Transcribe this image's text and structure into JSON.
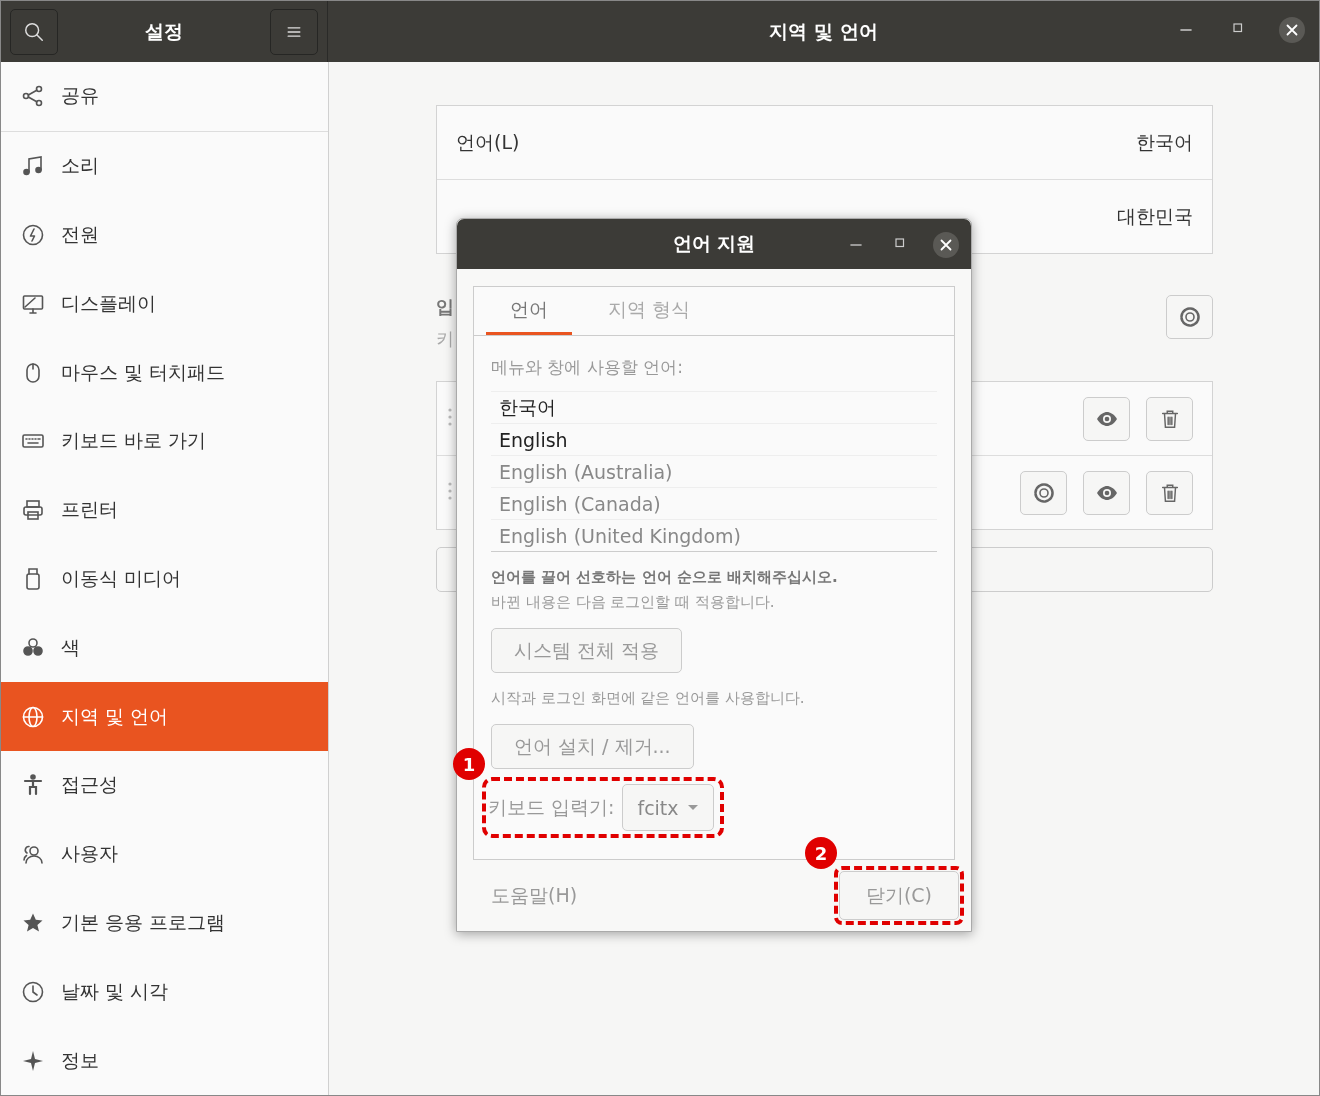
{
  "window": {
    "title": "지역 및 언어"
  },
  "sidebar": {
    "title": "설정",
    "items": [
      {
        "label": "공유",
        "selected": false
      },
      {
        "label": "소리",
        "selected": false
      },
      {
        "label": "전원",
        "selected": false
      },
      {
        "label": "디스플레이",
        "selected": false
      },
      {
        "label": "마우스 및 터치패드",
        "selected": false
      },
      {
        "label": "키보드 바로 가기",
        "selected": false
      },
      {
        "label": "프린터",
        "selected": false
      },
      {
        "label": "이동식 미디어",
        "selected": false
      },
      {
        "label": "색",
        "selected": false
      },
      {
        "label": "지역 및 언어",
        "selected": true
      },
      {
        "label": "접근성",
        "selected": false
      },
      {
        "label": "사용자",
        "selected": false
      },
      {
        "label": "기본 응용 프로그램",
        "selected": false
      },
      {
        "label": "날짜 및 시각",
        "selected": false
      },
      {
        "label": "정보",
        "selected": false
      }
    ]
  },
  "region_panel": {
    "rows": [
      {
        "label": "언어(L)",
        "value": "한국어"
      },
      {
        "value": "대한민국"
      }
    ]
  },
  "input_sources": {
    "title": "입",
    "subtitle": "키",
    "rows": [
      {
        "settings": false
      },
      {
        "settings": true
      }
    ]
  },
  "dialog": {
    "title": "언어 지원",
    "tabs": [
      {
        "label": "언어",
        "selected": true
      },
      {
        "label": "지역 형식",
        "selected": false
      }
    ],
    "prompt": "메뉴와 창에 사용할 언어:",
    "languages": [
      {
        "name": "한국어",
        "active": true
      },
      {
        "name": "English",
        "active": true
      },
      {
        "name": "English (Australia)",
        "active": false
      },
      {
        "name": "English (Canada)",
        "active": false
      },
      {
        "name": "English (United Kingdom)",
        "active": false
      }
    ],
    "hint": "언어를 끌어 선호하는 언어 순으로 배치해주십시오.",
    "note": "바뀐 내용은 다음 로그인할 때 적용합니다.",
    "apply_button": "시스템 전체 적용",
    "apply_note": "시작과 로그인 화면에 같은 언어를 사용합니다.",
    "install_button": "언어 설치 / 제거...",
    "input_method": {
      "label": "키보드 입력기:",
      "value": "fcitx"
    },
    "help_button": "도움말(H)",
    "close_button": "닫기(C)"
  },
  "annotations": [
    {
      "number": "1"
    },
    {
      "number": "2"
    }
  ]
}
